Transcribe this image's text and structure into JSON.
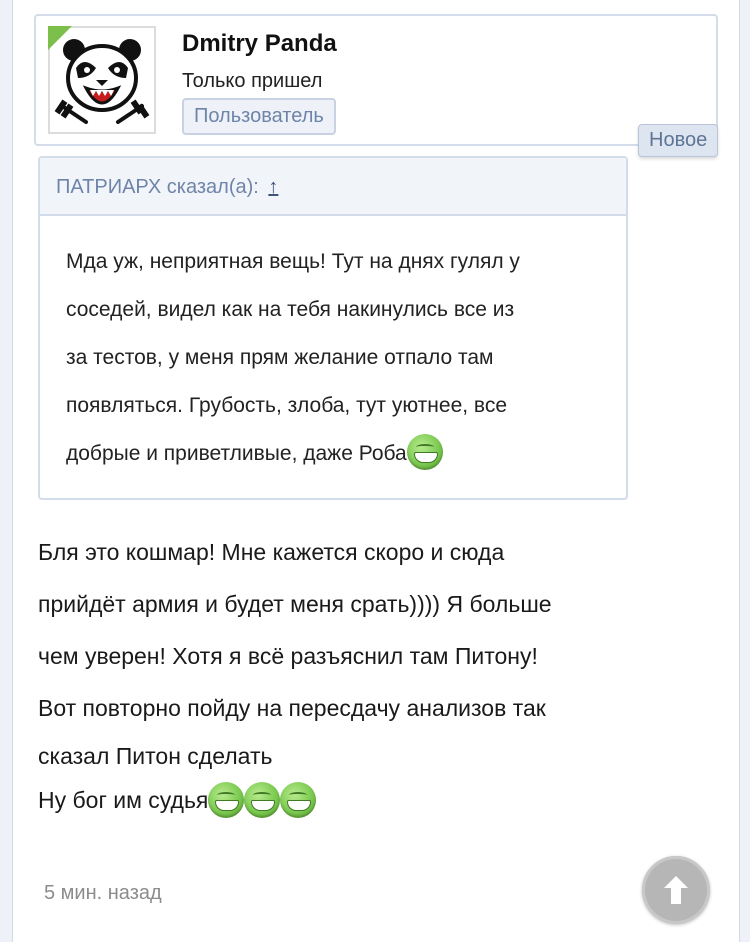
{
  "author": {
    "name": "Dmitry Panda",
    "status": "Только пришел",
    "role": "Пользователь",
    "avatar_icon": "panda-logo-icon",
    "online_color": "#7cc04b"
  },
  "new_badge": "Новое",
  "quote": {
    "header": "ПАТРИАРХ сказал(а):",
    "link_icon": "↑",
    "lines": [
      "Мда уж, неприятная вещь! Тут на днях гулял у",
      "соседей, видел как на тебя накинулись все из",
      "за тестов, у меня прям желание отпало там",
      "появляться. Грубость, злоба, тут уютнее, все",
      "добрые и приветливые, даже Роба"
    ],
    "emoji": "grin-smiley-icon"
  },
  "message": {
    "lines": [
      "Бля это кошмар! Мне кажется скоро и сюда",
      "прийдёт армия и будет меня срать)))) Я больше",
      "чем уверен! Хотя я всё разъяснил там Питону!",
      "Вот повторно пойду на пересдачу анализов так",
      "сказал Питон сделать",
      "Ну бог им судья"
    ],
    "emoji_count": 3
  },
  "timestamp": "5 мин. назад",
  "scroll_top_icon": "arrow-up-icon"
}
